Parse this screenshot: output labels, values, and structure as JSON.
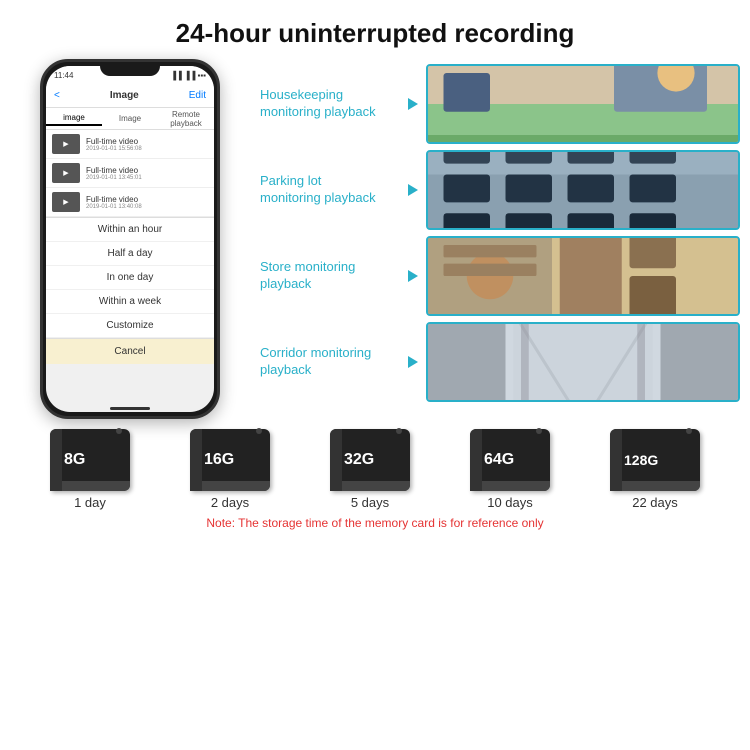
{
  "header": {
    "title": "24-hour uninterrupted recording"
  },
  "phone": {
    "status_time": "11:44",
    "nav_back": "<",
    "nav_title": "Image",
    "nav_edit": "Edit",
    "tab_image": "image",
    "tab_image2": "Image",
    "tab_remote": "Remote playback",
    "videos": [
      {
        "title": "Full-time video",
        "date": "2019-01-01 15:56:08"
      },
      {
        "title": "Full-time video",
        "date": "2019-01-01 13:45:01"
      },
      {
        "title": "Full-time video",
        "date": "2019-01-01 13:40:08"
      }
    ],
    "dropdown_items": [
      "Within an hour",
      "Half a day",
      "In one day",
      "Within a week",
      "Customize"
    ],
    "cancel_label": "Cancel"
  },
  "monitoring": [
    {
      "label": "Housekeeping\nmonitoring playback",
      "photo_class": "photo-housekeeping"
    },
    {
      "label": "Parking lot\nmonitoring playback",
      "photo_class": "photo-parking"
    },
    {
      "label": "Store monitoring\nplayback",
      "photo_class": "photo-store"
    },
    {
      "label": "Corridor monitoring\nplayback",
      "photo_class": "photo-corridor"
    }
  ],
  "storage": {
    "cards": [
      {
        "size": "8G",
        "days": "1 day"
      },
      {
        "size": "16G",
        "days": "2 days"
      },
      {
        "size": "32G",
        "days": "5 days"
      },
      {
        "size": "64G",
        "days": "10 days"
      },
      {
        "size": "128G",
        "days": "22 days"
      }
    ],
    "note": "Note: The storage time of the memory card is for reference only"
  }
}
